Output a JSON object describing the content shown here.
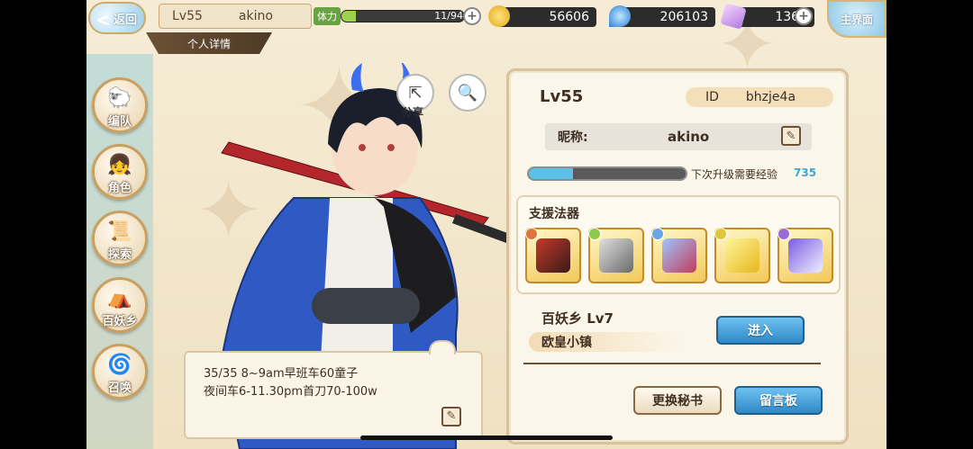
{
  "topbar": {
    "back_label": "返回",
    "level": "Lv55",
    "player_name": "akino",
    "profile_tab": "个人详情",
    "stamina_label": "体力",
    "stamina_value": "11/94",
    "stamina_fraction": 0.117,
    "gold": "56606",
    "soul_jade": "206103",
    "crystal": "1366",
    "home_label": "主界面"
  },
  "leftnav": {
    "items": [
      {
        "label": "编队",
        "icon": "team-icon"
      },
      {
        "label": "角色",
        "icon": "character-icon"
      },
      {
        "label": "探索",
        "icon": "explore-icon"
      },
      {
        "label": "百妖乡",
        "icon": "village-icon"
      },
      {
        "label": "召唤",
        "icon": "summon-icon"
      }
    ]
  },
  "actions": {
    "share_label": "分享"
  },
  "bubble": {
    "line1": "35/35 8~9am早班车60童子",
    "line2": "夜间车6-11.30pm首刀70-100w"
  },
  "panel": {
    "level": "Lv55",
    "id_label": "ID",
    "id_value": "bhzje4a",
    "nickname_label": "昵称:",
    "nickname_value": "akino",
    "exp_label": "下次升级需要经验",
    "exp_value": "735",
    "exp_fraction": 0.28,
    "support_title": "支援法器",
    "relics": [
      {
        "icon": "fan-relic-icon",
        "gem": "#e0733a"
      },
      {
        "icon": "crossbow-relic-icon",
        "gem": "#8acb4a"
      },
      {
        "icon": "fish-relic-icon",
        "gem": "#6aa6e0"
      },
      {
        "icon": "feather-relic-icon",
        "gem": "#e0c63a"
      },
      {
        "icon": "sword-relic-icon",
        "gem": "#9a6ad6"
      }
    ],
    "village_line": "百妖乡   Lv7",
    "town_name": "欧皇小镇",
    "enter_label": "进入",
    "change_secretary_label": "更换秘书",
    "message_board_label": "留言板"
  }
}
